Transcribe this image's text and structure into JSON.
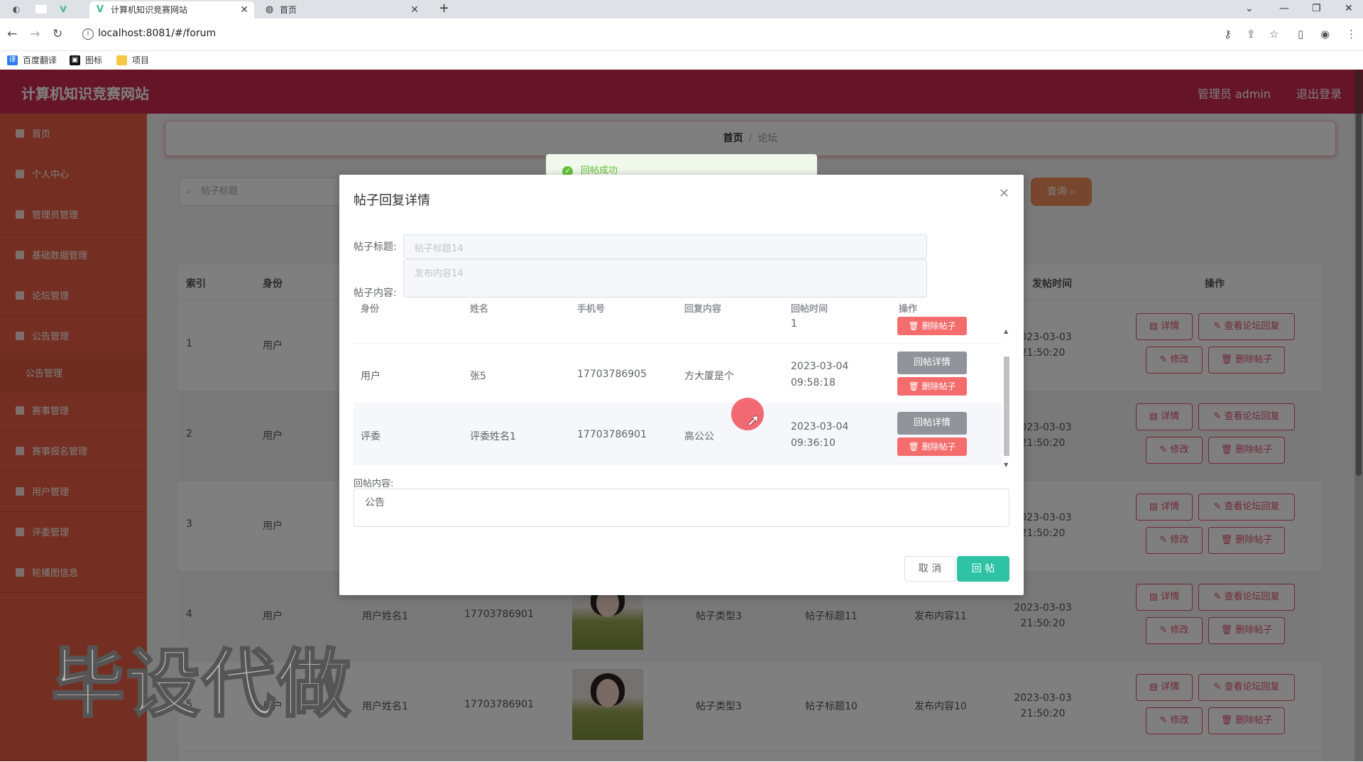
{
  "browser": {
    "tabs": [
      {
        "label": "计算机知识竞赛网站",
        "active": true
      },
      {
        "label": "首页",
        "active": false
      }
    ],
    "new_tab": "+",
    "url": "localhost:8081/#/forum",
    "bookmarks": [
      "百度翻译",
      "图标",
      "项目"
    ]
  },
  "header": {
    "site_title": "计算机知识竞赛网站",
    "admin_label": "管理员 admin",
    "logout_label": "退出登录"
  },
  "sidebar": {
    "items": [
      "首页",
      "个人中心",
      "管理员管理",
      "基础数据管理",
      "论坛管理",
      "公告管理",
      "公告管理",
      "赛事管理",
      "赛事报名管理",
      "用户管理",
      "评委管理",
      "轮播图信息"
    ]
  },
  "breadcrumb": {
    "home": "首页",
    "separator": "/",
    "current": "论坛"
  },
  "search": {
    "placeholder": "帖子标题",
    "query_label": "查询"
  },
  "table": {
    "headers": [
      "索引",
      "身份",
      "发帖时间",
      "操作"
    ],
    "rows": [
      {
        "index": "1",
        "identity": "用户",
        "name": "",
        "phone": "",
        "type": "",
        "title": "",
        "content": "",
        "time": "2023-03-03 21:50:20"
      },
      {
        "index": "2",
        "identity": "用户",
        "name": "",
        "phone": "",
        "type": "",
        "title": "",
        "content": "",
        "time": "2023-03-03 21:50:20"
      },
      {
        "index": "3",
        "identity": "用户",
        "name": "",
        "phone": "",
        "type": "",
        "title": "",
        "content": "",
        "time": "2023-03-03 21:50:20"
      },
      {
        "index": "4",
        "identity": "用户",
        "name": "用户姓名1",
        "phone": "17703786901",
        "type": "帖子类型3",
        "title": "帖子标题11",
        "content": "发布内容11",
        "time": "2023-03-03 21:50:20"
      },
      {
        "index": "5",
        "identity": "用户",
        "name": "用户姓名1",
        "phone": "17703786901",
        "type": "帖子类型3",
        "title": "帖子标题10",
        "content": "发布内容10",
        "time": "2023-03-03 21:50:20"
      }
    ],
    "actions": {
      "detail": "详情",
      "view_replies": "查看论坛回复",
      "edit": "修改",
      "delete": "删除帖子"
    }
  },
  "dialog": {
    "title": "帖子回复详情",
    "post_title_label": "帖子标题:",
    "post_title_value": "帖子标题14",
    "post_content_label": "帖子内容:",
    "post_content_value": "发布内容14",
    "reply_headers": [
      "身份",
      "姓名",
      "手机号",
      "回复内容",
      "回帖时间",
      "操作"
    ],
    "partial_row": {
      "time_tail": "1",
      "delete": "删除帖子"
    },
    "replies": [
      {
        "identity": "用户",
        "name": "张5",
        "phone": "17703786905",
        "content": "方大厦是个",
        "time": "2023-03-04 09:58:18"
      },
      {
        "identity": "评委",
        "name": "评委姓名1",
        "phone": "17703786901",
        "content": "高公公",
        "time": "2023-03-04 09:36:10"
      }
    ],
    "reply_detail_label": "回帖详情",
    "reply_delete_label": "删除帖子",
    "reply_content_label": "回帖内容:",
    "reply_content_value": "公告",
    "cancel_label": "取 消",
    "submit_label": "回 帖"
  },
  "toast": {
    "message": "回帖成功"
  },
  "watermark": "毕设代做",
  "colors": {
    "header": "#cd2b52",
    "sidebar": "#e95f45",
    "accent": "#e0506d",
    "submit": "#2dc3a4",
    "success": "#67c23a"
  }
}
